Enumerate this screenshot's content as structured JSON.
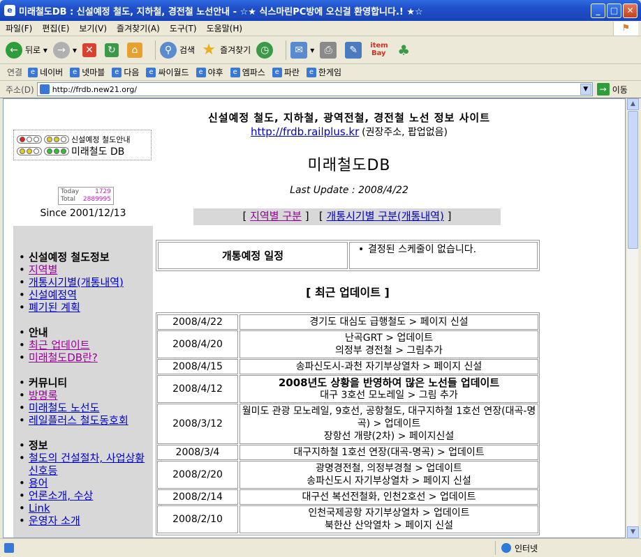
{
  "window": {
    "title": "미래철도DB : 신설예정 철도, 지하철, 경전철 노선안내 - ☆★ 식스마린PC방에 오신걸 환영합니다.! ★☆",
    "min": "_",
    "max": "□",
    "close": "✕"
  },
  "menu": [
    "파일(F)",
    "편집(E)",
    "보기(V)",
    "즐겨찾기(A)",
    "도구(T)",
    "도움말(H)"
  ],
  "toolbar": {
    "back": "뒤로",
    "search": "검색",
    "favorites": "즐겨찾기"
  },
  "links_bar": {
    "label": "연결",
    "items": [
      "네이버",
      "넷마블",
      "다음",
      "싸이월드",
      "야후",
      "엠파스",
      "파란",
      "한게임"
    ]
  },
  "address": {
    "label": "주소(D)",
    "url": "http://frdb.new21.org/",
    "go": "이동"
  },
  "status": {
    "zone": "인터넷"
  },
  "logo": {
    "line1": "신설예정 철도안내",
    "line2": "미래철도 DB"
  },
  "counter": {
    "today_label": "Today",
    "today": "1729",
    "total_label": "Total",
    "total": "2889995"
  },
  "since": "Since 2001/12/13",
  "header": {
    "heading": "신설예정 철도, 지하철, 광역전철, 경전철 노선 정보 사이트",
    "url": "http://frdb.railplus.kr",
    "url_note": "(권장주소, 팝업없음)",
    "title": "미래철도DB",
    "last_update": "Last Update : 2008/4/22"
  },
  "nav": {
    "open": "[",
    "region": "지역별 구분",
    "mid": "]   [",
    "period": "개통시기별 구분(개통내역)",
    "close": "]"
  },
  "sidebar": [
    {
      "heading": "신설예정 철도정보",
      "items": [
        "지역별",
        "개통시기별(개통내역)",
        "신설예정역",
        "폐기된 계획"
      ]
    },
    {
      "heading": "안내",
      "items": [
        "최근 업데이트",
        "미래철도DB란?"
      ]
    },
    {
      "heading": "커뮤니티",
      "items": [
        "방명록",
        "미래철도 노선도",
        "레일플러스 철도동호회"
      ]
    },
    {
      "heading": "정보",
      "items": [
        "철도의 건설절차, 사업상황 신호등",
        "용어",
        "언론소개, 수상",
        "Link",
        "운영자 소개"
      ]
    }
  ],
  "schedule": {
    "label": "개통예정 일정",
    "value": "결정된 스케줄이 없습니다."
  },
  "recent_heading": "[ 최근 업데이트 ]",
  "updates": [
    {
      "date": "2008/4/22",
      "lines": [
        "경기도 대심도 급행철도 > 페이지 신설"
      ]
    },
    {
      "date": "2008/4/20",
      "lines": [
        "난곡GRT > 업데이트",
        "의정부 경전철 > 그림추가"
      ]
    },
    {
      "date": "2008/4/15",
      "lines": [
        "송파신도시-과천 자기부상열차 > 페이지 신설"
      ]
    },
    {
      "date": "2008/4/12",
      "lines": [
        "2008년도 상황을 반영하여 많은 노선들 업데이트",
        "대구 3호선 모노레일 > 그림 추가"
      ]
    },
    {
      "date": "2008/3/12",
      "lines": [
        "월미도 관광 모노레일, 9호선, 공항철도, 대구지하철 1호선 연장(대곡-명곡) > 업데이트",
        "장항선 개량(2차) > 페이지신설"
      ]
    },
    {
      "date": "2008/3/4",
      "lines": [
        "대구지하철 1호선 연장(대곡-명곡) > 업데이트"
      ]
    },
    {
      "date": "2008/2/20",
      "lines": [
        "광명경전철, 의정부경철 > 업데이트",
        "송파신도시 자기부상열차 > 페이지 신설"
      ]
    },
    {
      "date": "2008/2/14",
      "lines": [
        "대구선 복선전철화, 인천2호선 > 업데이트"
      ]
    },
    {
      "date": "2008/2/10",
      "lines": [
        "인천국제공항 자기부상열차 > 업데이트",
        "북한산 산악열차 > 페이지 신설"
      ]
    }
  ]
}
